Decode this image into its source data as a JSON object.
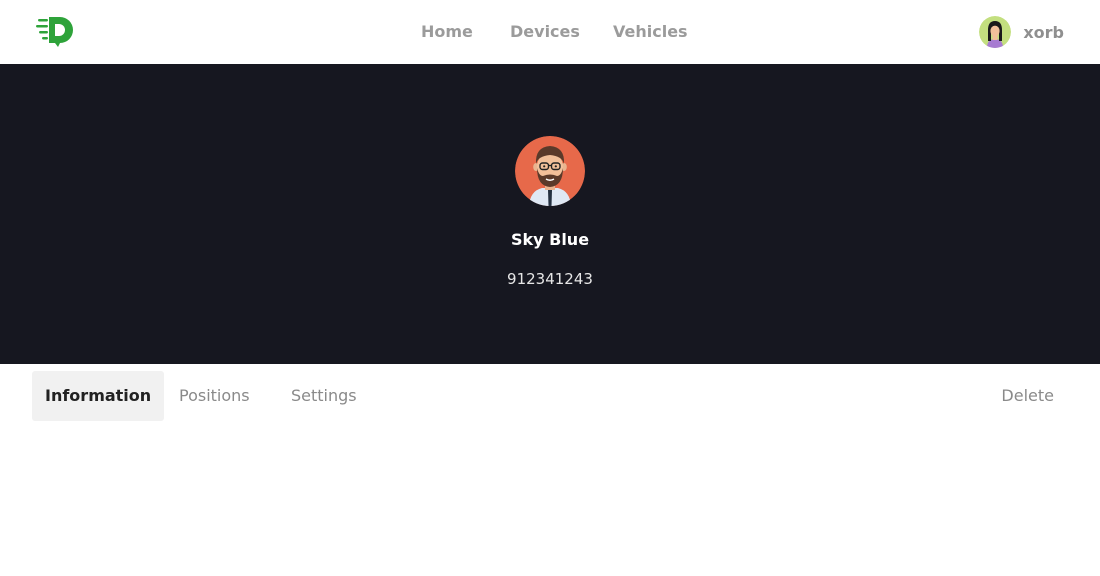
{
  "nav": {
    "home": "Home",
    "devices": "Devices",
    "vehicles": "Vehicles"
  },
  "user": {
    "name": "xorb"
  },
  "device": {
    "name": "Sky Blue",
    "id": "912341243"
  },
  "tabs": {
    "information": "Information",
    "positions": "Positions",
    "settings": "Settings",
    "delete": "Delete"
  },
  "colors": {
    "brand": "#2ea33a",
    "hero_bg": "#161720",
    "avatar_bg": "#e7694a",
    "user_avatar_bg": "#c3df7f"
  }
}
